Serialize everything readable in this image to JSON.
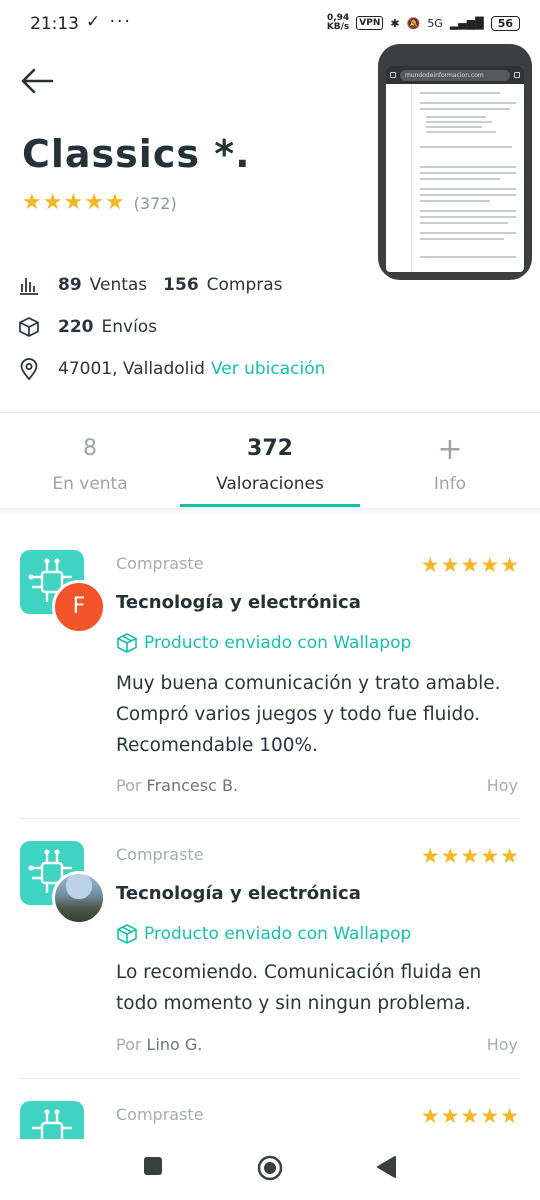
{
  "status_bar": {
    "time": "21:13",
    "left_icons": "✓ ···",
    "speed": "0,94\nKB/s",
    "vpn": "VPN",
    "signal": "5G",
    "battery": "56"
  },
  "profile": {
    "name": "Classics  *.",
    "rating_stars": 5,
    "rating_count": "(372)",
    "sales_count": "89",
    "sales_label": "Ventas",
    "purchases_count": "156",
    "purchases_label": "Compras",
    "shipments_count": "220",
    "shipments_label": "Envíos",
    "location": "47001, Valladolid",
    "location_link": "Ver ubicación"
  },
  "pip": {
    "url": "mundodeinformacion.com"
  },
  "tabs": [
    {
      "value": "8",
      "label": "En venta"
    },
    {
      "value": "372",
      "label": "Valoraciones"
    },
    {
      "value": "+",
      "label": "Info"
    }
  ],
  "reviews": [
    {
      "bought": "Compraste",
      "avatar_letter": "F",
      "category": "Tecnología y electrónica",
      "shipping": "Producto enviado con Wallapop",
      "text": "Muy buena comunicación y trato amable. Compró varios juegos y todo fue fluido. Recomendable 100%.",
      "by_prefix": "Por",
      "author": "Francesc B.",
      "date": "Hoy",
      "stars": 5
    },
    {
      "bought": "Compraste",
      "avatar_letter": "",
      "category": "Tecnología y electrónica",
      "shipping": "Producto enviado con Wallapop",
      "text": "Lo recomiendo. Comunicación fluida en todo momento y sin ningun problema.",
      "by_prefix": "Por",
      "author": "Lino G.",
      "date": "Hoy",
      "stars": 5
    },
    {
      "bought": "Compraste",
      "stars": 5
    }
  ],
  "colors": {
    "accent": "#13c1ac",
    "star": "#f4b623",
    "category_icon_bg": "#3fd3c2",
    "avatar_f": "#f4542a"
  }
}
